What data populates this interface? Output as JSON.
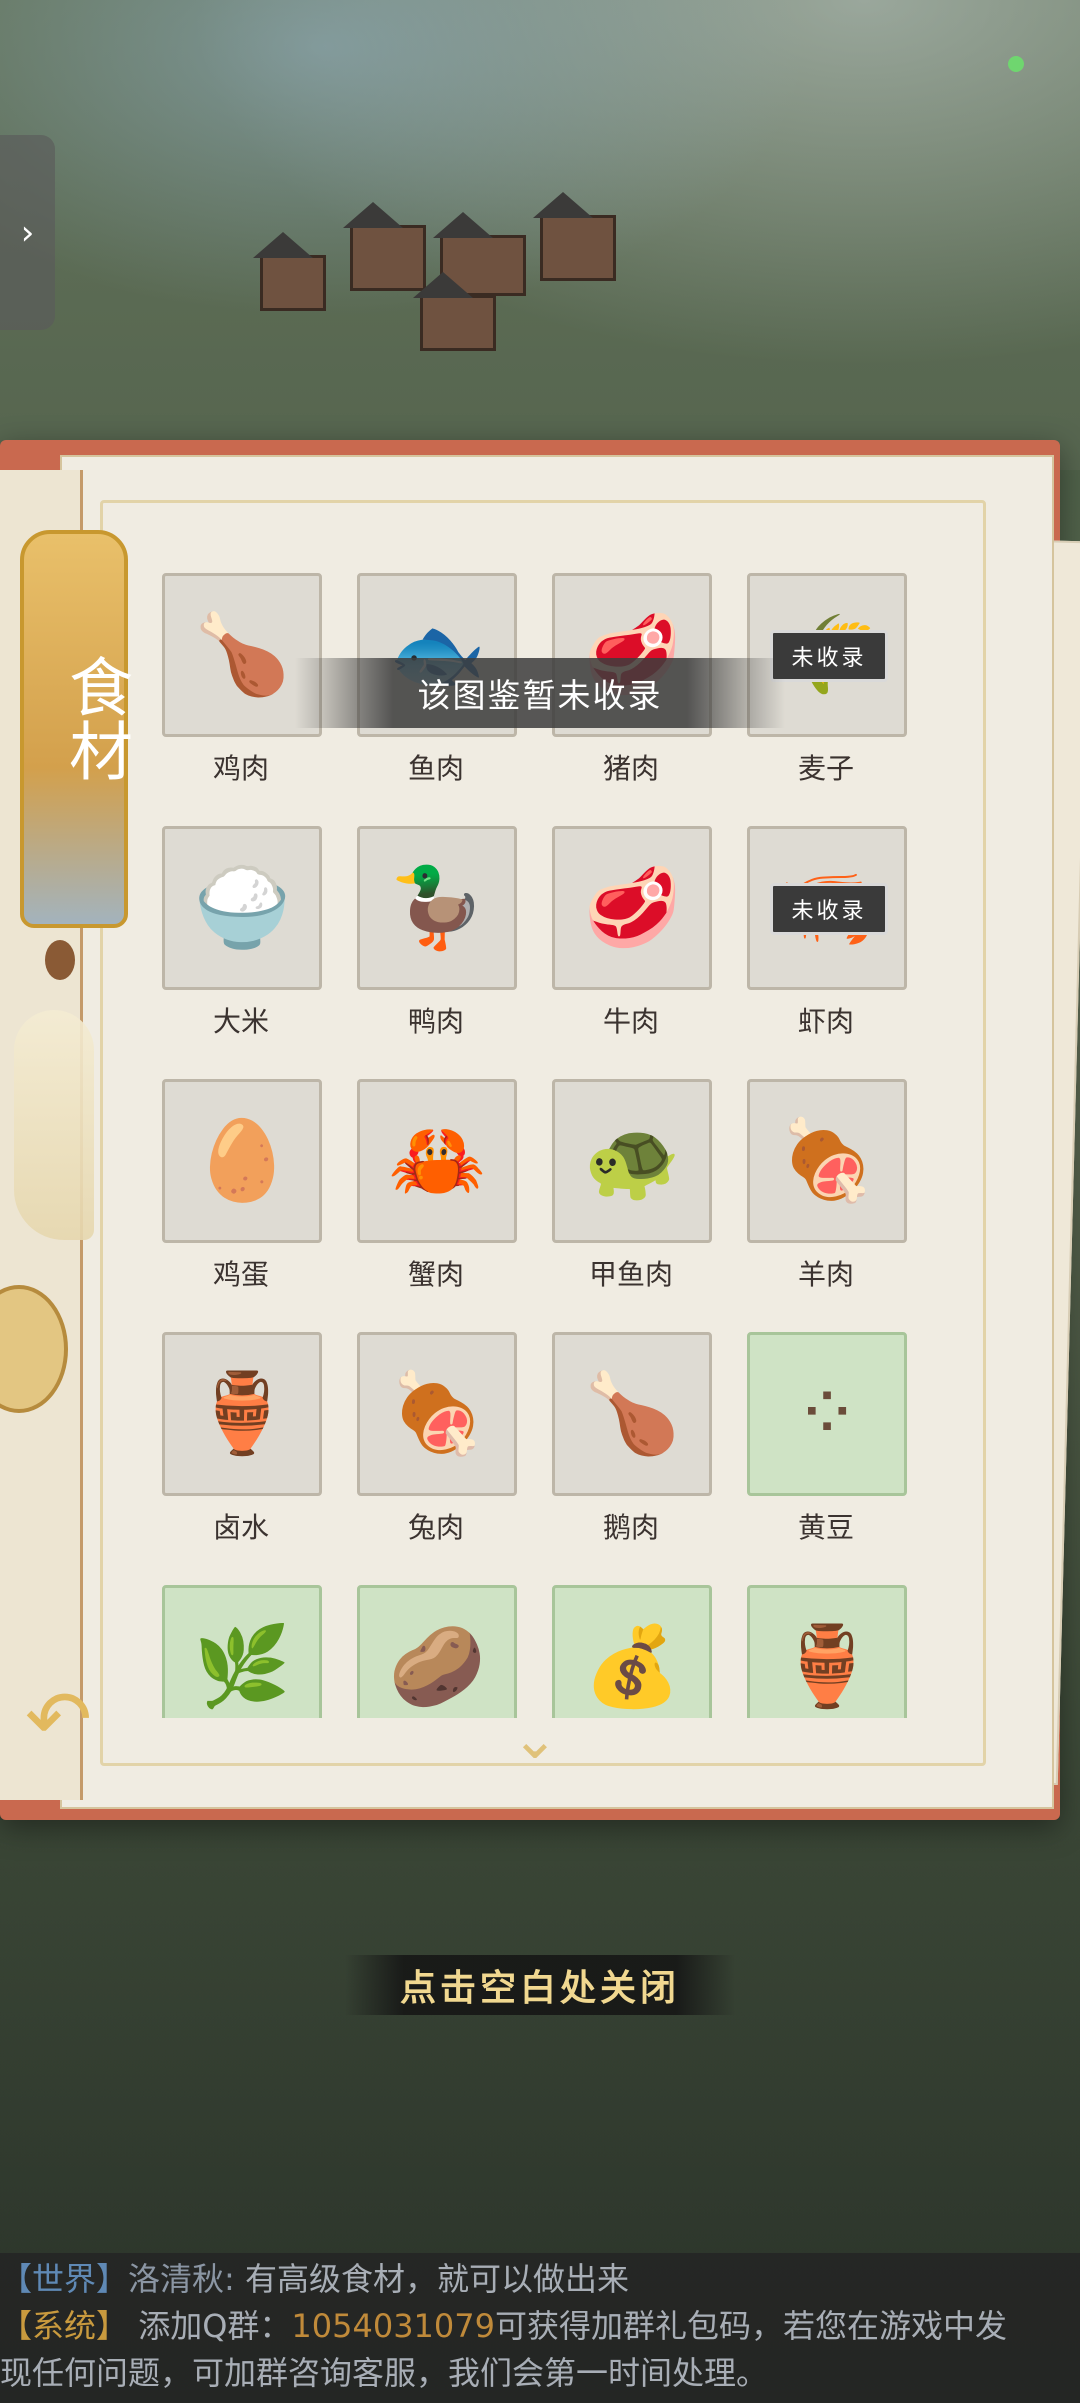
{
  "toast": "该图鉴暂未收录",
  "tab_title": "食材",
  "close_hint": "点击空白处关闭",
  "side_arrow": "›",
  "back_arrow": "↶",
  "scroll_arrow": "⌄",
  "stamp_text": "未收录",
  "ingredients": [
    {
      "name": "鸡肉",
      "icon": "chicken-icon",
      "glyph": "🍗",
      "found": false,
      "stamp": false
    },
    {
      "name": "鱼肉",
      "icon": "fish-steak-icon",
      "glyph": "🐟",
      "found": false,
      "stamp": false
    },
    {
      "name": "猪肉",
      "icon": "pork-icon",
      "glyph": "🥩",
      "found": false,
      "stamp": false
    },
    {
      "name": "麦子",
      "icon": "wheat-icon",
      "glyph": "🌾",
      "found": false,
      "stamp": true
    },
    {
      "name": "大米",
      "icon": "rice-sack-icon",
      "glyph": "🍚",
      "found": false,
      "stamp": false
    },
    {
      "name": "鸭肉",
      "icon": "duck-icon",
      "glyph": "🦆",
      "found": false,
      "stamp": false
    },
    {
      "name": "牛肉",
      "icon": "beef-icon",
      "glyph": "🥩",
      "found": false,
      "stamp": false
    },
    {
      "name": "虾肉",
      "icon": "shrimp-icon",
      "glyph": "🦐",
      "found": false,
      "stamp": true
    },
    {
      "name": "鸡蛋",
      "icon": "egg-icon",
      "glyph": "🥚",
      "found": false,
      "stamp": false
    },
    {
      "name": "蟹肉",
      "icon": "crab-icon",
      "glyph": "🦀",
      "found": false,
      "stamp": false
    },
    {
      "name": "甲鱼肉",
      "icon": "turtle-icon",
      "glyph": "🐢",
      "found": false,
      "stamp": false
    },
    {
      "name": "羊肉",
      "icon": "lamb-chop-icon",
      "glyph": "🍖",
      "found": false,
      "stamp": false
    },
    {
      "name": "卤水",
      "icon": "brine-jar-icon",
      "glyph": "🏺",
      "found": false,
      "stamp": false
    },
    {
      "name": "兔肉",
      "icon": "rabbit-meat-icon",
      "glyph": "🍖",
      "found": false,
      "stamp": false
    },
    {
      "name": "鹅肉",
      "icon": "goose-icon",
      "glyph": "🍗",
      "found": false,
      "stamp": false
    },
    {
      "name": "黄豆",
      "icon": "soybean-icon",
      "glyph": "⁘",
      "found": true,
      "stamp": false
    },
    {
      "name": "",
      "icon": "scallion-icon",
      "glyph": "🌿",
      "found": true,
      "stamp": false
    },
    {
      "name": "",
      "icon": "potato-icon",
      "glyph": "🥔",
      "found": true,
      "stamp": false
    },
    {
      "name": "",
      "icon": "sugar-sack-icon",
      "glyph": "💰",
      "found": true,
      "stamp": false
    },
    {
      "name": "",
      "icon": "vinegar-jar-icon",
      "glyph": "🏺",
      "found": true,
      "stamp": false
    }
  ],
  "chat": {
    "line1_channel": "【世界】",
    "line1_name": "洛清秋:",
    "line1_text": " 有高级食材，就可以做出来",
    "line2_channel": "【系统】",
    "line2_text1": " 添加Q群：",
    "line2_qq": "1054031079",
    "line2_text2": "可获得加群礼包码，若您在游戏中发",
    "line3_text": "现任何问题，可加群咨询客服，我们会第一时间处理。"
  }
}
